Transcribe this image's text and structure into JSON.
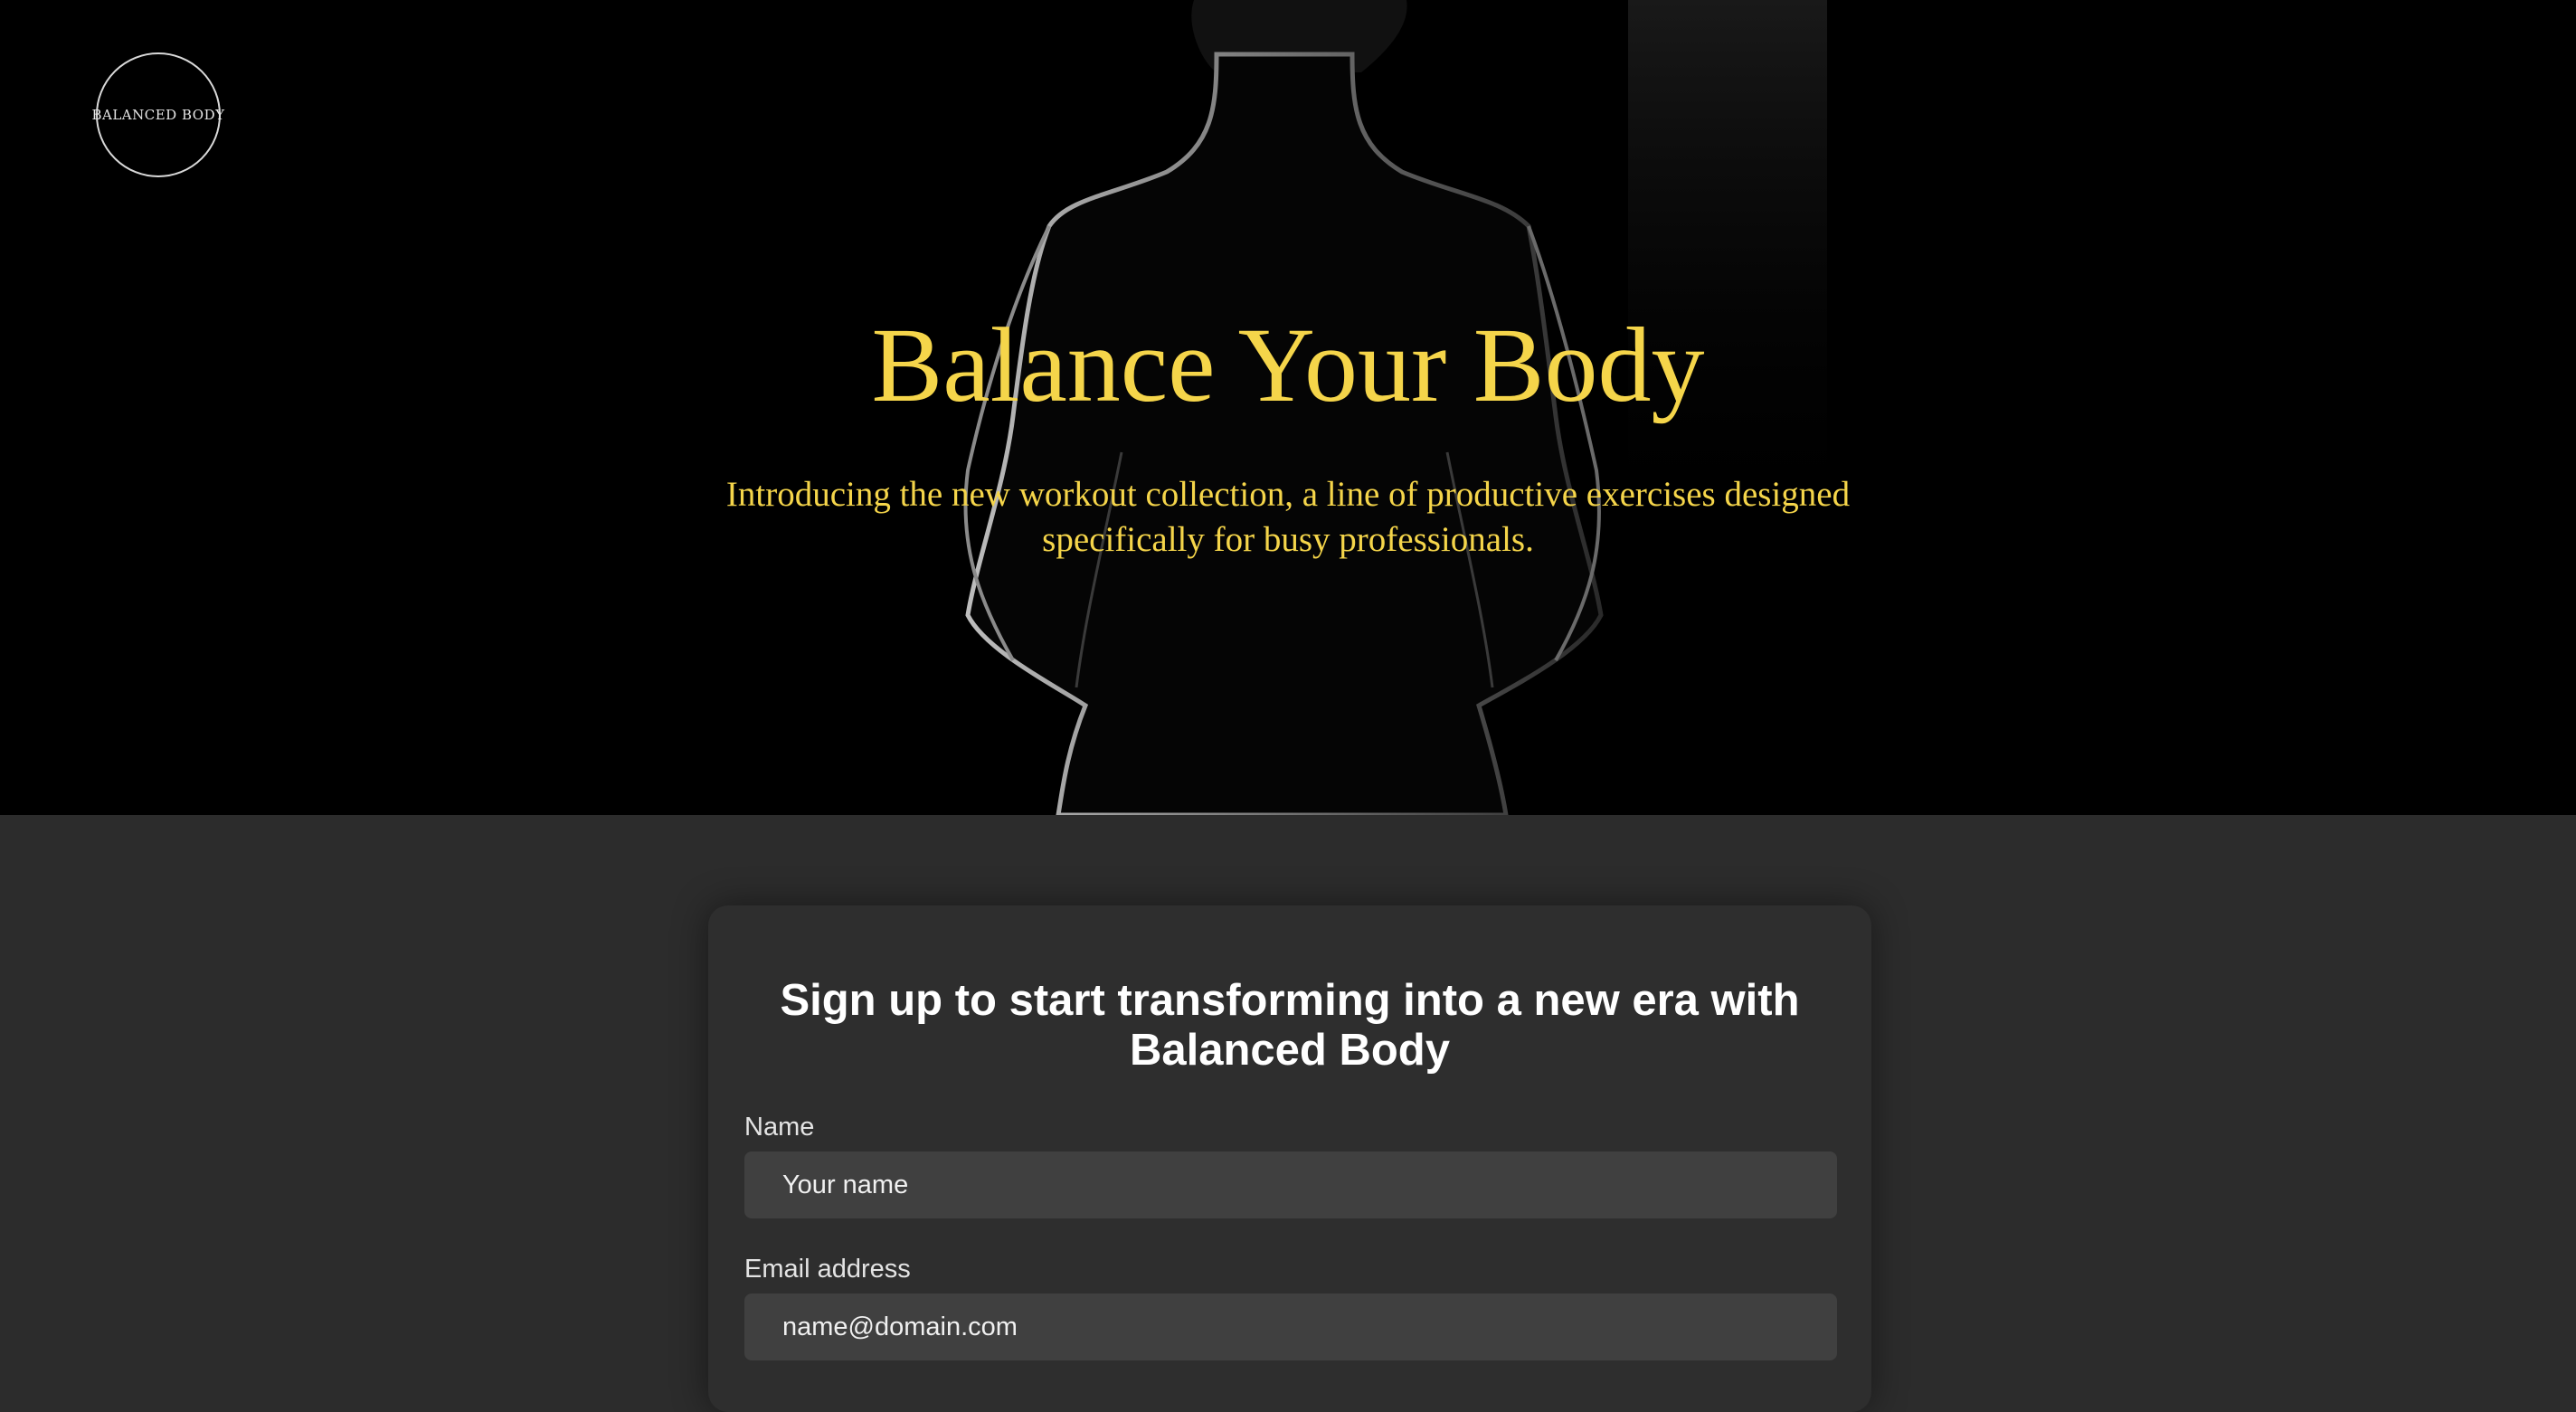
{
  "header": {
    "logo_text": "BALANCED BODY"
  },
  "hero": {
    "title": "Balance Your Body",
    "subtitle": "Introducing the new workout collection, a line of productive exercises designed specifically for busy professionals."
  },
  "signup": {
    "heading": "Sign up to start transforming into a new era with Balanced Body",
    "fields": [
      {
        "label": "Name",
        "placeholder": "Your name"
      },
      {
        "label": "Email address",
        "placeholder": "name@domain.com"
      }
    ]
  },
  "colors": {
    "accent": "#f5d54a",
    "hero_background": "#000000",
    "page_background": "#2c2c2c",
    "card_background": "#2e2e2e",
    "input_background": "#404040"
  }
}
